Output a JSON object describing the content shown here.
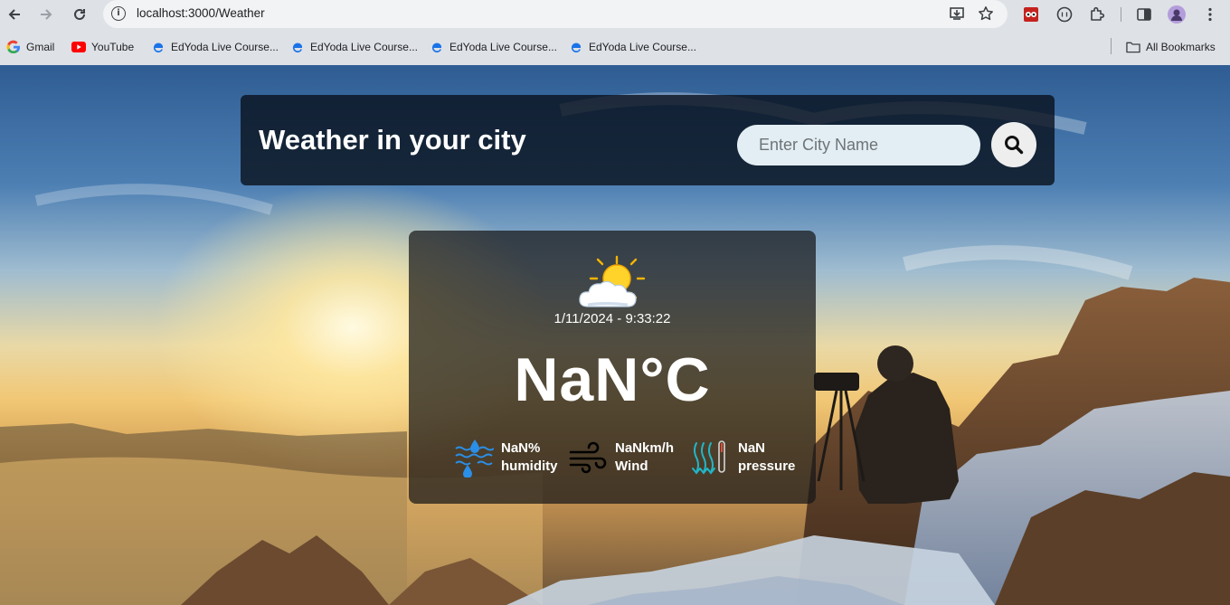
{
  "browser": {
    "url": "localhost:3000/Weather",
    "bookmarks": [
      {
        "label": "Gmail",
        "icon": "gmail-icon"
      },
      {
        "label": "YouTube",
        "icon": "youtube-icon"
      },
      {
        "label": "EdYoda Live Course...",
        "icon": "edyoda-icon"
      },
      {
        "label": "EdYoda Live Course...",
        "icon": "edyoda-icon"
      },
      {
        "label": "EdYoda Live Course...",
        "icon": "edyoda-icon"
      },
      {
        "label": "EdYoda Live Course...",
        "icon": "edyoda-icon"
      }
    ],
    "all_bookmarks_label": "All Bookmarks"
  },
  "header": {
    "title": "Weather in your city",
    "search_placeholder": "Enter City Name",
    "search_value": ""
  },
  "weather": {
    "icon": "sun-behind-cloud-icon",
    "datetime": "1/11/2024 - 9:33:22",
    "temperature": "NaN°C",
    "humidity": {
      "value": "NaN%",
      "label": "humidity",
      "icon": "humidity-icon"
    },
    "wind": {
      "value": "NaNkm/h",
      "label": "Wind",
      "icon": "wind-icon"
    },
    "pressure": {
      "value": "NaN",
      "label": "pressure",
      "icon": "pressure-icon"
    }
  },
  "colors": {
    "card_bg": "#161618",
    "header_bg": "#080e18",
    "input_bg": "#e2eef3",
    "accent_blue": "#1a73e8"
  }
}
